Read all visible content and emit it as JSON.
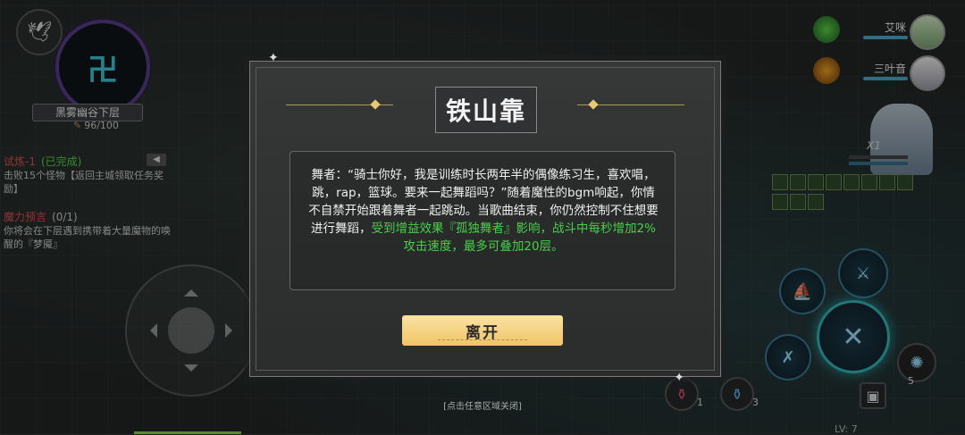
{
  "top_left": {
    "back_icon": "bird-icon",
    "location": "黑雾幽谷下层",
    "stamina": "96/100"
  },
  "quests": {
    "collapse_symbol": "◀",
    "q1_title": "试炼-1",
    "q1_status": "(已完成)",
    "q1_desc": "击败15个怪物【返回主城领取任务奖励】",
    "q2_title": "魔力预言",
    "q2_progress": "(0/1)",
    "q2_desc": "你将会在下层遇到携带着大量魔物的唤醒的『梦魇』"
  },
  "party": {
    "member1": "艾咪",
    "member2": "三叶音",
    "speed": "X1"
  },
  "dialog": {
    "title": "铁山靠",
    "story_plain": "舞者：“骑士你好，我是训练时长两年半的偶像练习生，喜欢唱，跳，rap，篮球。要来一起舞蹈吗？”随着魔性的bgm响起，你情不自禁开始跟着舞者一起跳动。当歌曲结束，你仍然控制不住想要进行舞蹈，",
    "story_effect": "受到增益效果『孤独舞者』影响，战斗中每秒增加2%攻击速度，最多可叠加20层。",
    "leave_label": "离开"
  },
  "close_hint": "[点击任意区域关闭]",
  "items": {
    "potion_red_count": "1",
    "potion_blue_count": "3",
    "skill_count": "5"
  },
  "level": "LV: 7",
  "colors": {
    "accent_gold": "#f0c465",
    "effect_green": "#48d04a",
    "quest_red": "#e05050"
  }
}
